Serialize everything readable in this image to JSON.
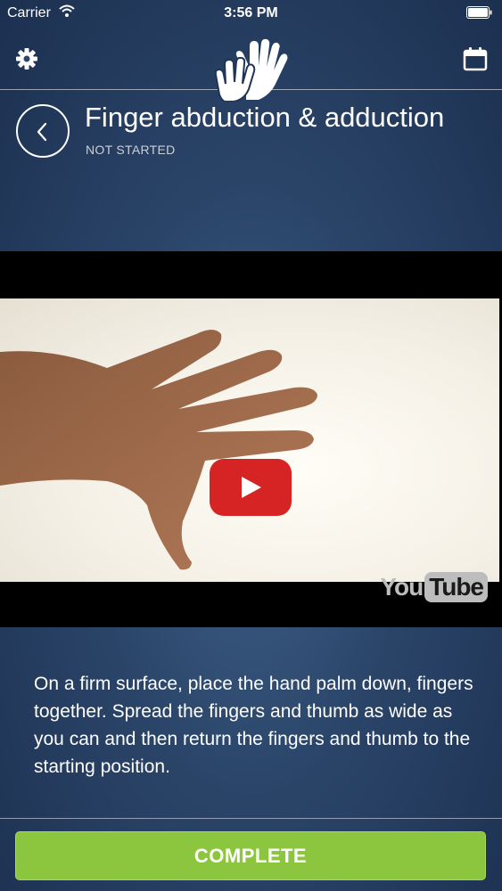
{
  "status_bar": {
    "carrier": "Carrier",
    "time": "3:56 PM"
  },
  "nav": {
    "left_icon": "gear-icon",
    "center_icon": "hands-logo-icon",
    "right_icon": "calendar-icon"
  },
  "exercise": {
    "title": "Finger abduction & adduction",
    "status": "NOT STARTED"
  },
  "video": {
    "play_icon": "play-icon",
    "provider": {
      "you": "You",
      "tube": "Tube"
    }
  },
  "description": "On a firm surface, place the hand palm down, fingers together. Spread the fingers and thumb as wide as you can and then return the fingers and thumb to the starting position.",
  "footer": {
    "complete_label": "COMPLETE"
  },
  "colors": {
    "accent_green": "#8cc63f",
    "youtube_red": "#d62424",
    "background_blue": "#2a4468"
  }
}
